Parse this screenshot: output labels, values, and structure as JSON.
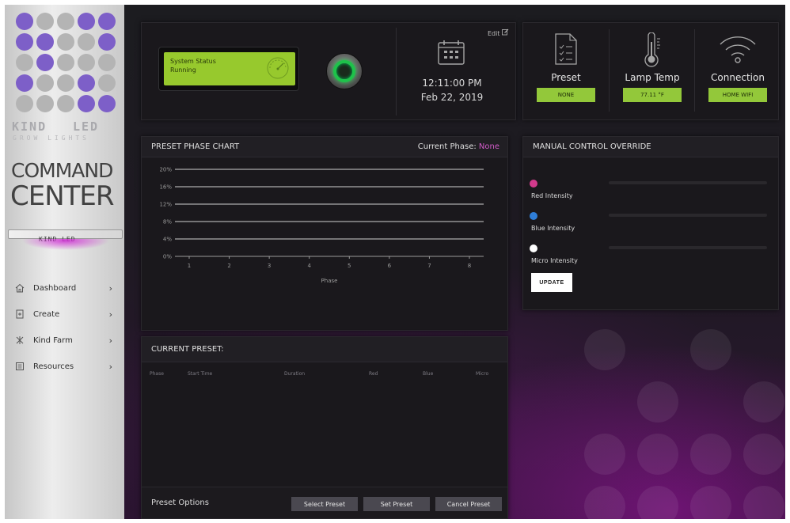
{
  "brand": {
    "kind": "KIND",
    "led": "LED",
    "grow": "GROW LIGHTS",
    "command": "COMMAND",
    "center": "CENTER",
    "fixture_label": "KIND LED"
  },
  "nav": [
    {
      "label": "Dashboard",
      "icon": "home-icon"
    },
    {
      "label": "Create",
      "icon": "create-icon"
    },
    {
      "label": "Kind Farm",
      "icon": "farm-icon"
    },
    {
      "label": "Resources",
      "icon": "resources-icon"
    }
  ],
  "status": {
    "lcd_line1": "System Status",
    "lcd_line2": "Running",
    "edit_label": "Edit",
    "time": "12:11:00 PM",
    "date": "Feb 22, 2019"
  },
  "info": {
    "preset_label": "Preset",
    "preset_value": "NONE",
    "lamp_label": "Lamp Temp",
    "lamp_value": "77.11 °F",
    "connection_label": "Connection",
    "connection_value": "HOME WIFI"
  },
  "chart_panel": {
    "title": "PRESET PHASE CHART",
    "current_label": "Current Phase:",
    "current_value": "None"
  },
  "chart_data": {
    "type": "line",
    "x": [
      1,
      2,
      3,
      4,
      5,
      6,
      7,
      8
    ],
    "y_ticks": [
      "0%",
      "4%",
      "8%",
      "12%",
      "16%",
      "20%"
    ],
    "ylim": [
      0,
      20
    ],
    "xlabel": "Phase",
    "ylabel": "",
    "grid": true,
    "series": []
  },
  "manual": {
    "title": "MANUAL CONTROL OVERRIDE",
    "channels": [
      {
        "label": "Red Intensity",
        "color": "#d23a8c"
      },
      {
        "label": "Blue Intensity",
        "color": "#2f7ed8"
      },
      {
        "label": "Micro Intensity",
        "color": "#ffffff"
      }
    ],
    "update_label": "UPDATE"
  },
  "current_preset": {
    "title": "CURRENT PRESET:",
    "columns": [
      "Phase",
      "Start Time",
      "Duration",
      "Red",
      "Blue",
      "Micro"
    ],
    "options_label": "Preset Options",
    "buttons": [
      "Select Preset",
      "Set Preset",
      "Cancel Preset"
    ]
  }
}
